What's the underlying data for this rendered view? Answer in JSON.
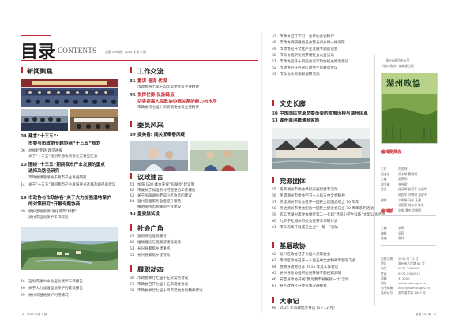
{
  "header": {
    "title_cn": "目录",
    "title_en": "CONTENTS",
    "issue_info": "总第 209 期 · 2015 年第 6 期"
  },
  "colors": {
    "accent": "#c0262b",
    "section_icon": "#c0262b"
  },
  "left": {
    "section": "新闻聚焦",
    "items": [
      {
        "page": "04",
        "title": "建言“十三五”:",
        "sub": "市委与市政协专题协商“十三五”规划",
        "desc": ""
      },
      {
        "page": "06",
        "title": "",
        "sub": "",
        "desc": "总规划专题 意见通报"
      },
      {
        "page": "",
        "title": "",
        "sub": "",
        "desc": "关于“十三五”规划专题协商会各方意见汇总"
      },
      {
        "page": "10",
        "title": "围绕“十三五”期间我市产业发展的重点",
        "sub": "选择及路径研究",
        "desc": "市政协课题组关于我市产业发展研究"
      },
      {
        "page": "14",
        "title": "",
        "sub": "",
        "desc": "关于“十三五”期间我市产业发展重点选择及路径的建议"
      },
      {
        "page": "19",
        "title": "市政协与市政协各“关于大力加强湿地保护",
        "sub": "的对策研究”开展专题协商",
        "desc": ""
      },
      {
        "page": "20",
        "title": "",
        "sub": "",
        "desc": "保护湿地资源 净化城市“绿肺”"
      },
      {
        "page": "",
        "title": "",
        "sub": "",
        "desc": "湖州市湿地保护工作综述"
      },
      {
        "page": "24",
        "title": "",
        "sub": "",
        "desc": "湿地向湖州本地湿地保护工作报告"
      },
      {
        "page": "26",
        "title": "",
        "sub": "",
        "desc": "关于大力加强湿地保护的建议报告"
      },
      {
        "page": "29",
        "title": "",
        "sub": "",
        "desc": "杭州湾湿地保护利用情况"
      }
    ]
  },
  "middle": {
    "sections": [
      {
        "name": "工作交流",
        "items": [
          {
            "page": "31",
            "title": "重谋 善谋 优谋",
            "desc": "市政协将七届十四次常委会议主要精神"
          },
          {
            "page": "35",
            "title": "发挥优势 弘扬特点",
            "desc": ""
          },
          {
            "page": "",
            "title": "切实提高人民政协协商关系的能力与水平",
            "desc": "市政协将七届十四次常委会议主要精神"
          }
        ]
      },
      {
        "name": "委员风采",
        "items": [
          {
            "page": "39",
            "title": "提美香: 阅关爱奉春风绽",
            "desc": ""
          }
        ]
      },
      {
        "name": "议政建言",
        "items": [
          {
            "page": "41",
            "title": "",
            "desc": "加强 G20 峰会安保“照湖亮”建议我"
          },
          {
            "page": "42",
            "title": "",
            "desc": "市委关于加强农村河道整治工作建议"
          },
          {
            "page": "43",
            "title": "",
            "desc": "关于加强湖州老旧小区改造的建议"
          },
          {
            "page": "44",
            "title": "",
            "desc": "温州管理服务全面提升策略"
          },
          {
            "page": "",
            "title": "",
            "desc": "推进湖州市物联网产业建设"
          },
          {
            "page": "43",
            "title": "重委旗试设",
            "desc": ""
          }
        ]
      },
      {
        "name": "社会广角",
        "items": [
          {
            "page": "47",
            "title": "",
            "desc": "紧抓保险能源服务"
          },
          {
            "page": "48",
            "title": "",
            "desc": "推动理论与观察部建设发展"
          },
          {
            "page": "51",
            "title": "",
            "desc": "长兴县聚焦乡建重点"
          },
          {
            "page": "55",
            "title": "",
            "desc": "长兴县聚焦乡建有效"
          }
        ]
      },
      {
        "name": "履职动态",
        "items": [
          {
            "page": "56",
            "title": "",
            "desc": "市政协举行七届十五次常务会议"
          },
          {
            "page": "57",
            "title": "",
            "desc": "市政协召开七届十五次常委会议"
          },
          {
            "page": "58",
            "title": "",
            "desc": "市政协举行七届十四次常委会议精神传达"
          }
        ]
      }
    ]
  },
  "right": {
    "top_items": [
      {
        "page": "47",
        "desc": "市政协召开学习一会传达会议精神"
      },
      {
        "page": "48",
        "desc": "市政协调研组委员会暨长兴乡村一线调研"
      },
      {
        "page": "49",
        "desc": "市政协召开文化产业发展专题座谈会"
      },
      {
        "page": "50",
        "desc": "市政协组织委员开展社会公益活动"
      },
      {
        "page": "51",
        "desc": "市政协召开十四届会议市政协机关党风建设"
      },
      {
        "page": "52",
        "desc": "市政协召开各县区政协主席联席会议"
      },
      {
        "page": "53",
        "desc": "市政协委员视察调研活动"
      }
    ],
    "sections": [
      {
        "name": "文史长廊",
        "items": [
          {
            "page": "50",
            "title": "中国国民党革命委员会的发展历程与湖州民革",
            "desc": ""
          },
          {
            "page": "53",
            "title": "湖州南浔籍通商家族",
            "desc": ""
          }
        ]
      },
      {
        "name": "党派团体",
        "items": [
          {
            "page": "55",
            "desc": "民革湖州市委会举行庆祝建党节活动"
          },
          {
            "page": "56",
            "desc": "民盟湖州市委会学习十八届五中全会精神"
          },
          {
            "page": "57",
            "desc": "民建湖州市委会召开中国民主建国会成立 70 周年"
          },
          {
            "page": "58",
            "desc": "民进湖州市委会纪念中国民主促进会成立 70 周年系列活动"
          },
          {
            "page": "59",
            "desc": "农工党湖州市委会举行第二十七届“活跃小学生科技”大型公益活动"
          },
          {
            "page": "60",
            "desc": "九三学社湖州市委会召开工作研讨会"
          },
          {
            "page": "61",
            "desc": "市工商联开展成员企业“一帮一”活动"
          }
        ]
      },
      {
        "name": "基层政协",
        "items": [
          {
            "page": "62",
            "desc": "吴兴区政协召开七届八次常委会"
          },
          {
            "page": "63",
            "desc": "南浔区政协召开十八届五中全会精神专题学习会"
          },
          {
            "page": "64",
            "desc": "德清县政协召开 2015 年度工作会议"
          },
          {
            "page": "65",
            "desc": "长兴县政协组织委员开展专题视察调研"
          },
          {
            "page": "66",
            "desc": "安吉县政协开展“我为我市发展献一计”活动"
          },
          {
            "page": "67",
            "desc": "县区政协召开委员情况通报会"
          }
        ]
      },
      {
        "name": "大事记",
        "items": [
          {
            "page": "69",
            "desc": "2015 年市政协大事记 (11-12 月)"
          }
        ]
      }
    ]
  },
  "sidebar": {
    "host": "湖州市政协办公室",
    "publication": "《湖州政协》编辑部出版",
    "cover_title": "湖州政協",
    "committee_title": "编辑委员会",
    "committee": [
      {
        "role": "主任",
        "name": "刘志炜"
      },
      {
        "role": "副主任",
        "name": "吴水琴 费俊明"
      },
      {
        "role": "主编",
        "name": "吴宪明"
      },
      {
        "role": "副主编",
        "name": "张伟斌"
      },
      {
        "role": "委员",
        "name": "任开明 张哲军 孙建华"
      },
      {
        "role": "",
        "name": "陆国华 许晓明 金建平"
      },
      {
        "role": "编辑",
        "name": "丁明娟 马庆 王建"
      },
      {
        "role": "",
        "name": "沈国荣 何永祥 陈华"
      },
      {
        "role": "",
        "name": "刘俊 潘中 沈雅明"
      }
    ],
    "dept_title": "编辑部",
    "dept": [
      {
        "role": "主编",
        "name": "李莉"
      },
      {
        "role": "编辑",
        "name": "吴莉"
      },
      {
        "role": "美编",
        "name": "邱林"
      }
    ],
    "info": [
      {
        "label": "出版日期",
        "value": "2015 年 12 月"
      },
      {
        "label": "地址",
        "value": "湖州市人民路 61 号"
      },
      {
        "label": "电话",
        "value": "0572-2068502"
      },
      {
        "label": "传真",
        "value": "0572-2068515"
      },
      {
        "label": "邮编",
        "value": "313000"
      },
      {
        "label": "网址",
        "value": "zxb.huzhou.gov.cn"
      },
      {
        "label": "电子邮箱",
        "value": "zxxx@huzhou.gov.cn"
      },
      {
        "label": "准印证号",
        "value": "浙内准字第 2007 号"
      }
    ]
  },
  "footer": {
    "left": "· 2 ·  2015 年第 6 期",
    "right": "总第 209 期  · 3 ·"
  }
}
